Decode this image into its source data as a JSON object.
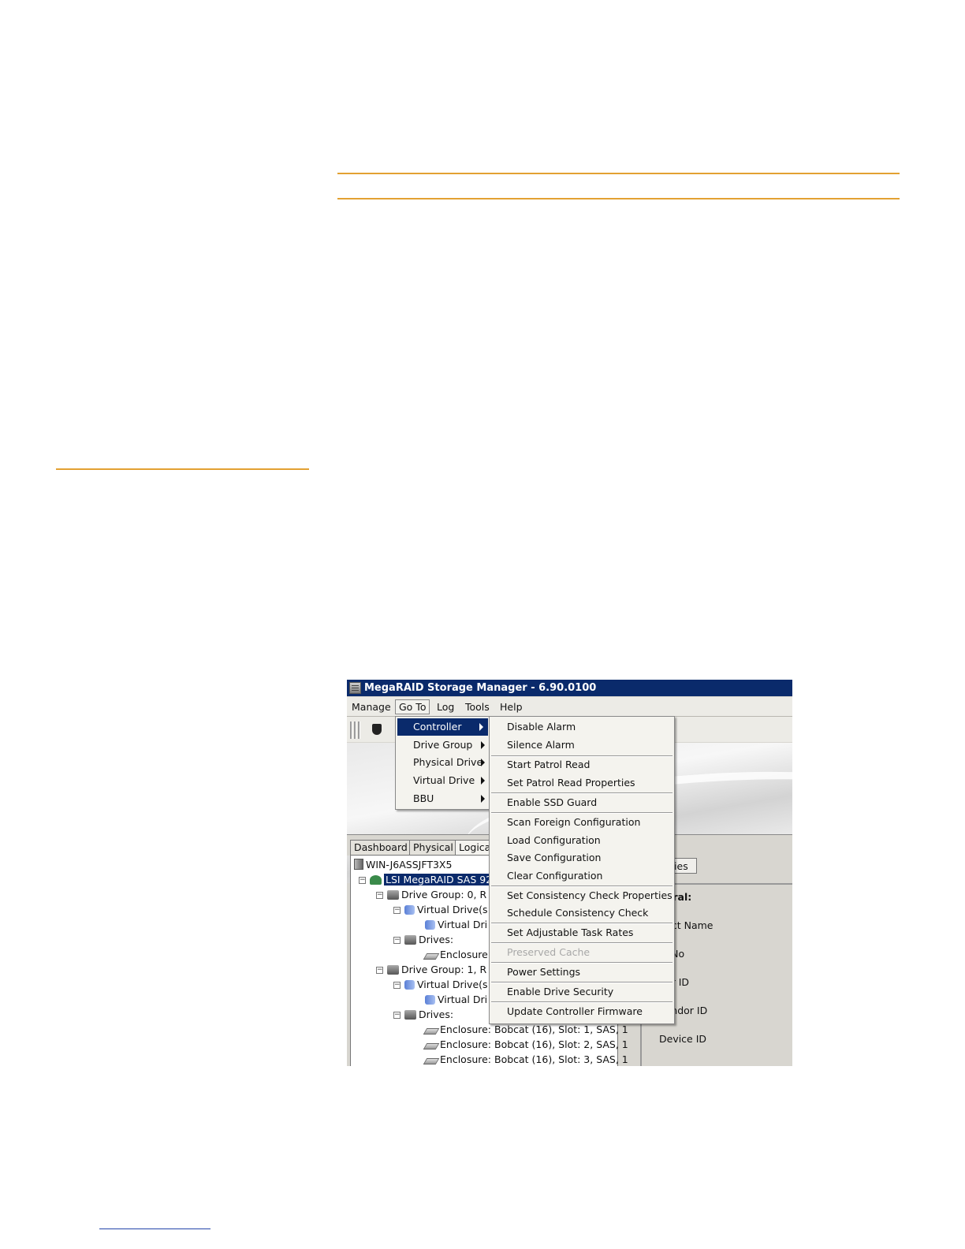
{
  "window": {
    "title": "MegaRAID Storage Manager - 6.90.0100"
  },
  "menubar": [
    "Manage",
    "Go To",
    "Log",
    "Tools",
    "Help"
  ],
  "goto_menu": [
    {
      "label": "Controller",
      "submenu": true,
      "highlighted": true
    },
    {
      "label": "Drive Group",
      "submenu": true
    },
    {
      "label": "Physical Drive",
      "submenu": true
    },
    {
      "label": "Virtual Drive",
      "submenu": true
    },
    {
      "label": "BBU",
      "submenu": true
    }
  ],
  "controller_menu": [
    {
      "label": "Disable Alarm"
    },
    {
      "label": "Silence Alarm"
    },
    {
      "label": "Start Patrol Read"
    },
    {
      "label": "Set Patrol Read Properties"
    },
    {
      "label": "Enable SSD Guard"
    },
    {
      "label": "Scan Foreign Configuration"
    },
    {
      "label": "Load Configuration"
    },
    {
      "label": "Save Configuration"
    },
    {
      "label": "Clear Configuration"
    },
    {
      "label": "Set Consistency Check Properties"
    },
    {
      "label": "Schedule Consistency Check"
    },
    {
      "label": "Set Adjustable Task Rates"
    },
    {
      "label": "Preserved Cache",
      "disabled": true
    },
    {
      "label": "Power Settings"
    },
    {
      "label": "Enable Drive Security"
    },
    {
      "label": "Update Controller Firmware"
    }
  ],
  "tabs": [
    "Dashboard",
    "Physical",
    "Logica"
  ],
  "tree": [
    {
      "label": "WIN-J6ASSJFT3X5",
      "icon": "server-icon"
    },
    {
      "label": "LSI MegaRAID SAS 92",
      "icon": "controller-icon",
      "selected": true
    },
    {
      "label": "Drive Group: 0, R",
      "icon": "drive-group-icon"
    },
    {
      "label": "Virtual Drive(s",
      "icon": "virtual-drives-icon"
    },
    {
      "label": "Virtual Dri",
      "icon": "virtual-drive-icon"
    },
    {
      "label": "Drives:",
      "icon": "drives-icon"
    },
    {
      "label": "Enclosure",
      "icon": "drive-icon"
    },
    {
      "label": "Drive Group: 1, R",
      "icon": "drive-group-icon"
    },
    {
      "label": "Virtual Drive(s",
      "icon": "virtual-drives-icon"
    },
    {
      "label": "Virtual Dri",
      "icon": "virtual-drive-icon"
    },
    {
      "label": "Drives:",
      "icon": "drives-icon"
    },
    {
      "label": "Enclosure: Bobcat (16), Slot: 1, SAS, 1",
      "icon": "drive-icon"
    },
    {
      "label": "Enclosure: Bobcat (16), Slot: 2, SAS, 1",
      "icon": "drive-icon"
    },
    {
      "label": "Enclosure: Bobcat (16), Slot: 3, SAS, 1",
      "icon": "drive-icon"
    }
  ],
  "properties": {
    "tab": "rties",
    "heading": "neral:",
    "fields": [
      "duct Name",
      "al No",
      "dor ID",
      "Vendor ID",
      "Device ID"
    ]
  },
  "colors": {
    "accent_rule": "#e3a132",
    "titlebar": "#0a2a6b",
    "highlight": "#0a2a6b"
  }
}
